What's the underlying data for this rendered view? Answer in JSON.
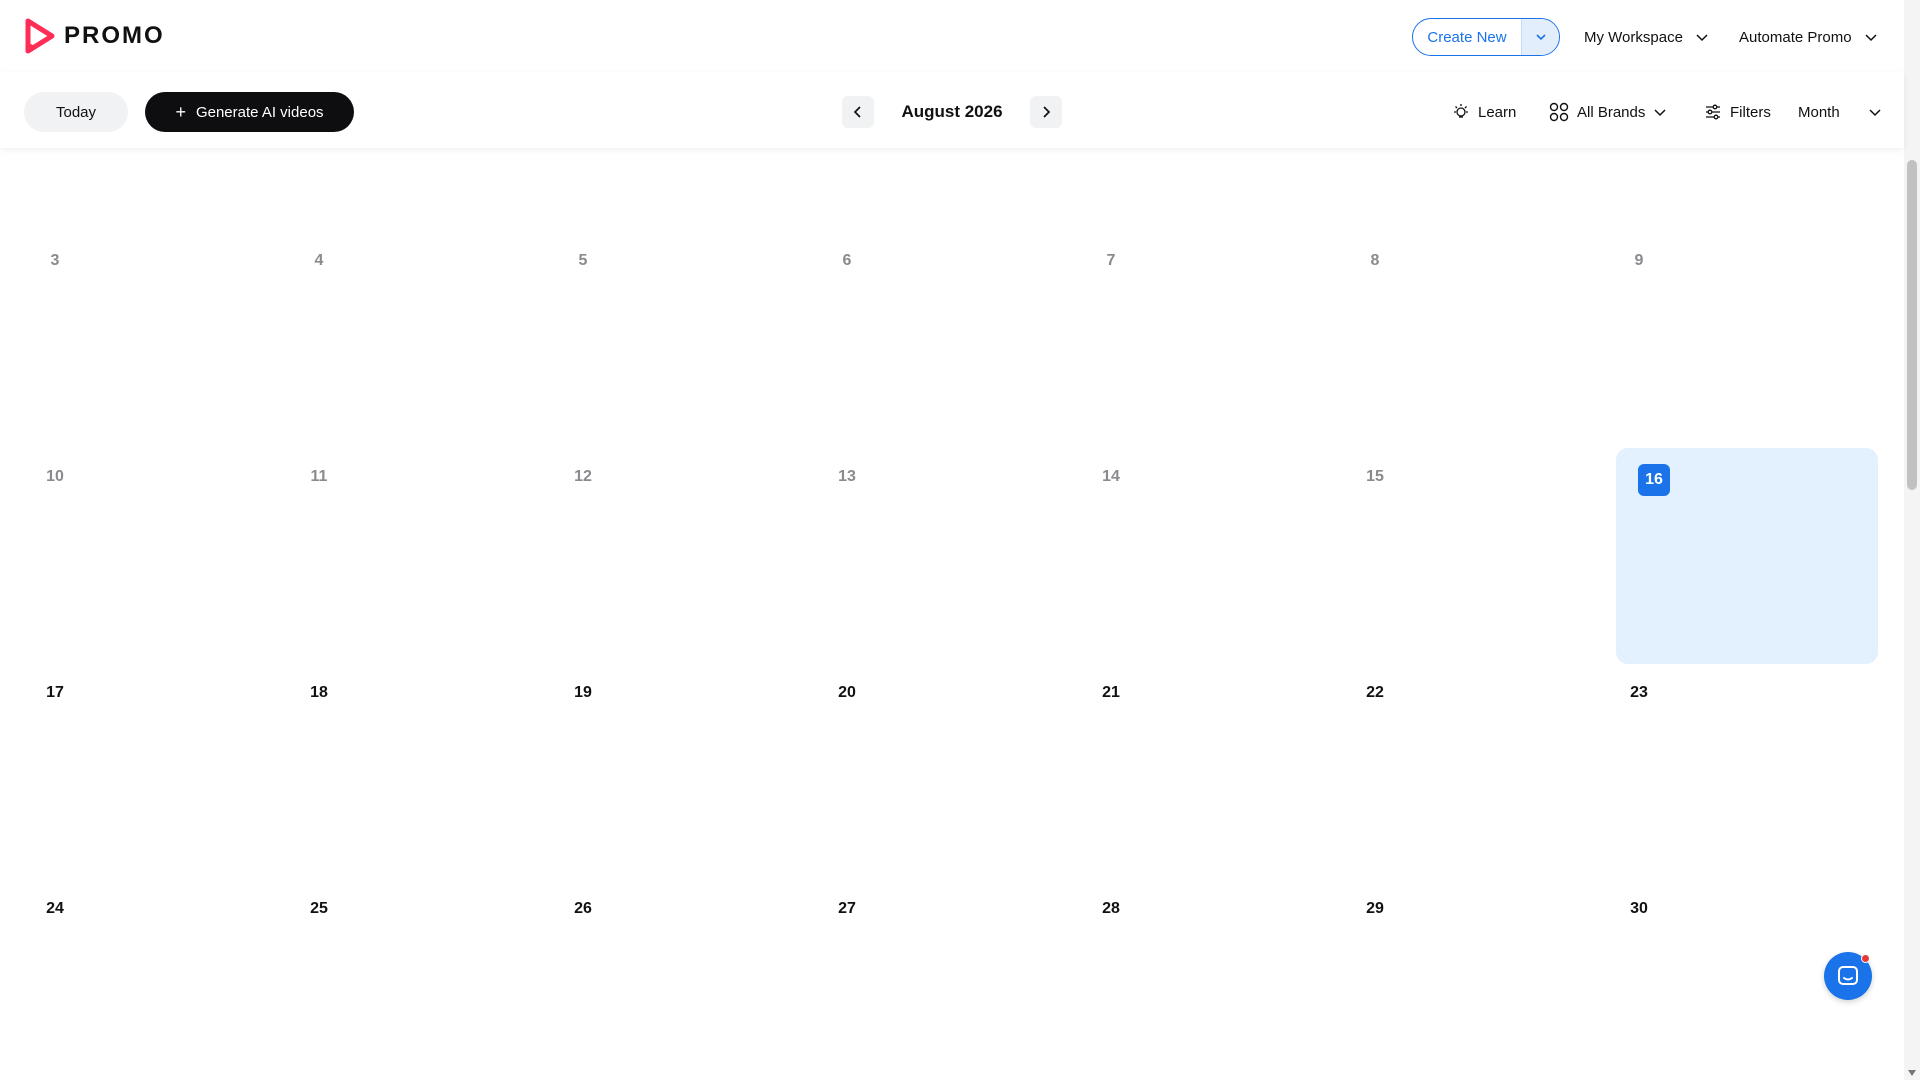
{
  "brand": {
    "name": "PROMO",
    "accent": "#ff2d55"
  },
  "header": {
    "create_new_label": "Create New",
    "workspace_label": "My Workspace",
    "automate_label": "Automate Promo"
  },
  "toolbar": {
    "today_label": "Today",
    "generate_label": "Generate AI videos",
    "month_title": "August 2026",
    "learn_label": "Learn",
    "brands_label": "All Brands",
    "filters_label": "Filters",
    "view_label": "Month"
  },
  "calendar": {
    "today": "16",
    "weeks": [
      [
        "3",
        "4",
        "5",
        "6",
        "7",
        "8",
        "9"
      ],
      [
        "10",
        "11",
        "12",
        "13",
        "14",
        "15",
        "16"
      ],
      [
        "17",
        "18",
        "19",
        "20",
        "21",
        "22",
        "23"
      ],
      [
        "24",
        "25",
        "26",
        "27",
        "28",
        "29",
        "30"
      ]
    ]
  },
  "colors": {
    "primary": "#1a73e8",
    "today_bg": "#e3f0fd",
    "dark_button": "#0e0e10"
  },
  "icons": {
    "prev": "chevron-left-icon",
    "next": "chevron-right-icon",
    "learn": "lightbulb-icon",
    "brands": "grid-circles-icon",
    "filters": "sliders-icon",
    "chat": "chat-icon"
  }
}
